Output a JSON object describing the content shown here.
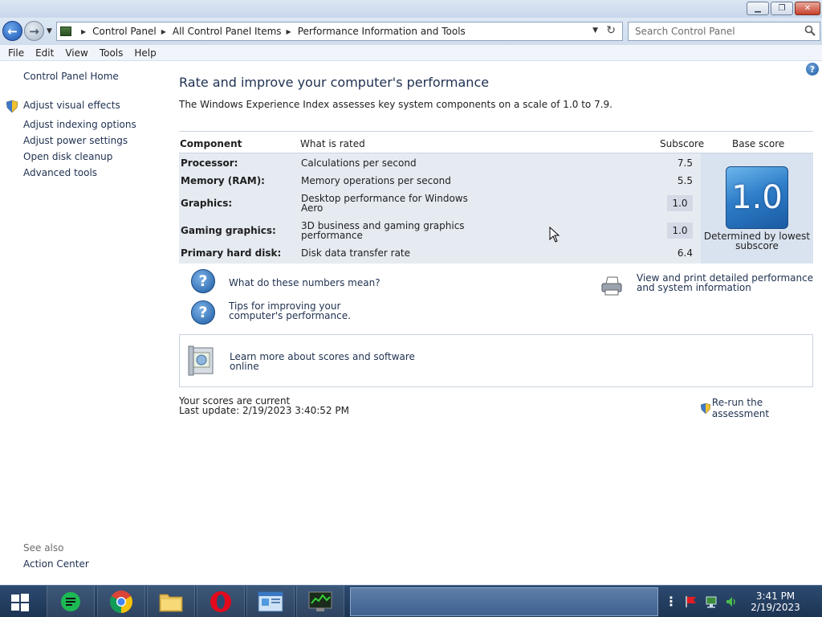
{
  "window": {
    "minimize_glyph": "▁",
    "maximize_glyph": "❐",
    "close_glyph": "✕"
  },
  "nav": {
    "breadcrumbs": [
      "Control Panel",
      "All Control Panel Items",
      "Performance Information and Tools"
    ],
    "search_placeholder": "Search Control Panel"
  },
  "menu": [
    "File",
    "Edit",
    "View",
    "Tools",
    "Help"
  ],
  "sidebar": {
    "home": "Control Panel Home",
    "links": [
      "Adjust visual effects",
      "Adjust indexing options",
      "Adjust power settings",
      "Open disk cleanup",
      "Advanced tools"
    ],
    "see_also_label": "See also",
    "see_also_links": [
      "Action Center"
    ]
  },
  "main": {
    "title": "Rate and improve your computer's performance",
    "description": "The Windows Experience Index assesses key system components on a scale of 1.0 to 7.9.",
    "table": {
      "headers": {
        "component": "Component",
        "rated": "What is rated",
        "subscore": "Subscore",
        "base": "Base score"
      },
      "rows": [
        {
          "component": "Processor:",
          "rated": "Calculations per second",
          "subscore": "7.5"
        },
        {
          "component": "Memory (RAM):",
          "rated": "Memory operations per second",
          "subscore": "5.5"
        },
        {
          "component": "Graphics:",
          "rated": "Desktop performance for Windows Aero",
          "subscore": "1.0"
        },
        {
          "component": "Gaming graphics:",
          "rated": "3D business and gaming graphics performance",
          "subscore": "1.0"
        },
        {
          "component": "Primary hard disk:",
          "rated": "Disk data transfer rate",
          "subscore": "6.4"
        }
      ],
      "base_score": "1.0",
      "base_caption": "Determined by lowest subscore"
    },
    "links": {
      "numbers_meaning": "What do these numbers mean?",
      "tips": "Tips for improving your computer's performance.",
      "print_details": "View and print detailed performance and system information",
      "learn_more": "Learn more about scores and software online"
    },
    "status": {
      "current": "Your scores are current",
      "last_update": "Last update: 2/19/2023 3:40:52 PM",
      "rerun": "Re-run the assessment"
    }
  },
  "taskbar": {
    "time": "3:41 PM",
    "date": "2/19/2023"
  }
}
